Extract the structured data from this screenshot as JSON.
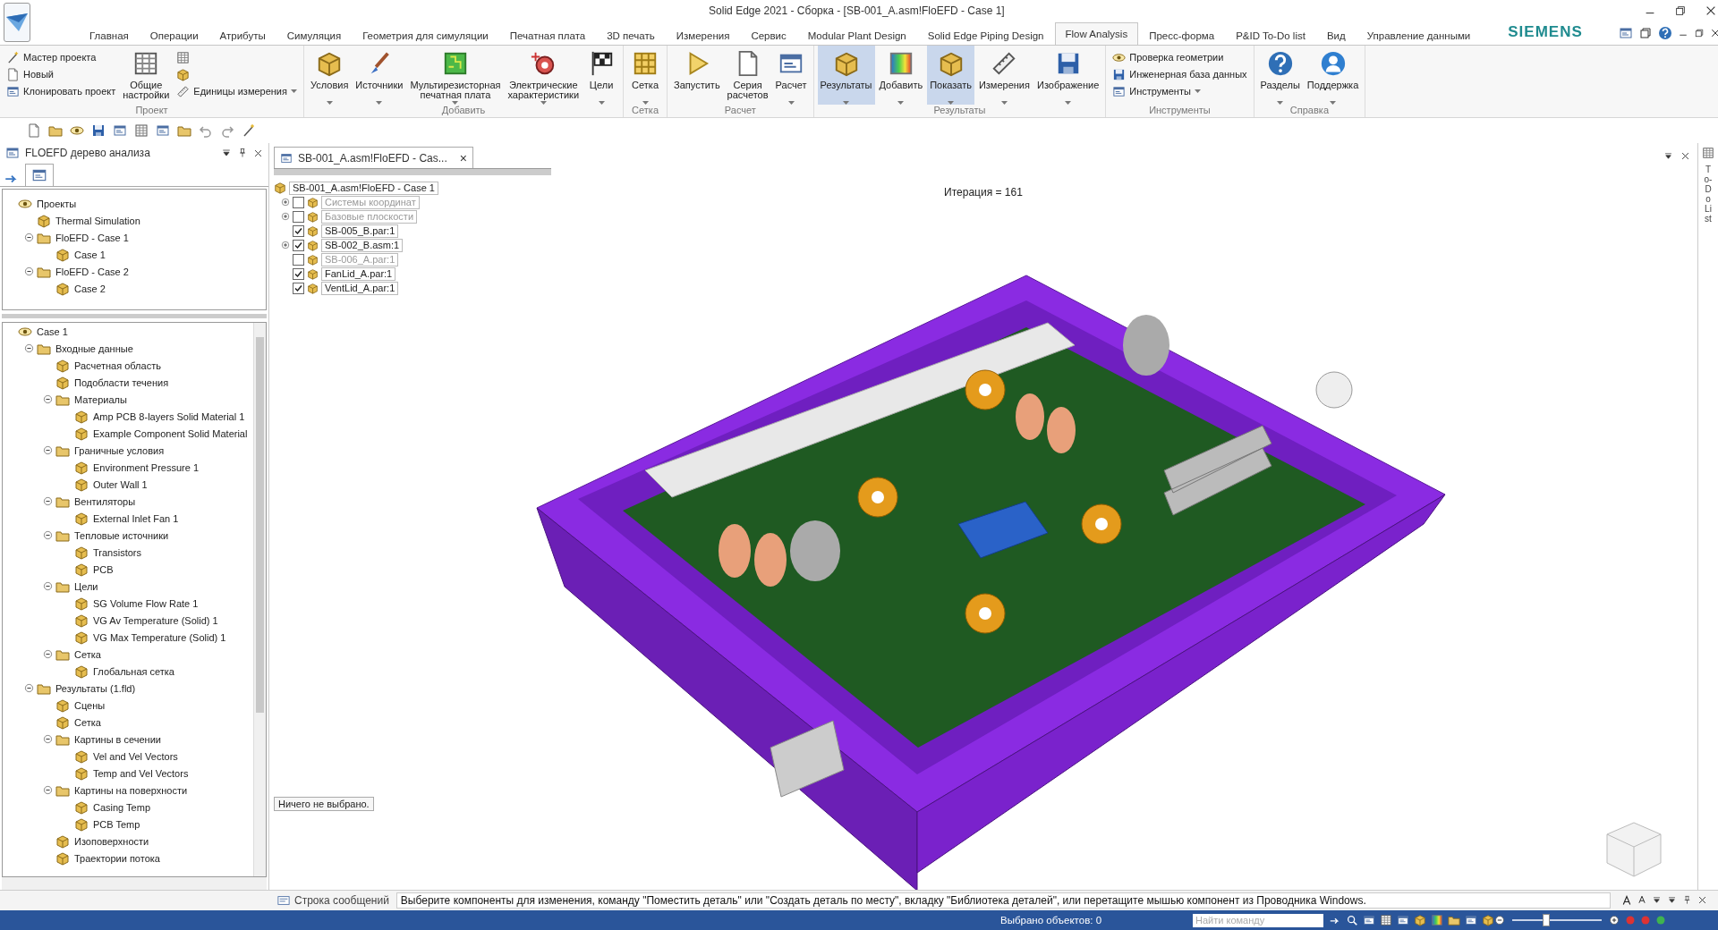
{
  "window": {
    "title": "Solid Edge 2021 - Сборка - [SB-001_A.asm!FloEFD - Case 1]"
  },
  "ribbon_tabs": [
    {
      "label": "Главная",
      "selected": false
    },
    {
      "label": "Операции",
      "selected": false
    },
    {
      "label": "Атрибуты",
      "selected": false
    },
    {
      "label": "Симуляция",
      "selected": false
    },
    {
      "label": "Геометрия для симуляции",
      "selected": false
    },
    {
      "label": "Печатная плата",
      "selected": false
    },
    {
      "label": "3D печать",
      "selected": false
    },
    {
      "label": "Измерения",
      "selected": false
    },
    {
      "label": "Сервис",
      "selected": false
    },
    {
      "label": "Modular Plant Design",
      "selected": false
    },
    {
      "label": "Solid Edge Piping Design",
      "selected": false
    },
    {
      "label": "Flow Analysis",
      "selected": true
    },
    {
      "label": "Пресс-форма",
      "selected": false
    },
    {
      "label": "P&ID To-Do list",
      "selected": false
    },
    {
      "label": "Вид",
      "selected": false
    },
    {
      "label": "Управление данными",
      "selected": false
    }
  ],
  "brand": "SIEMENS",
  "ribbon_groups": [
    {
      "title": "Проект",
      "items": [
        {
          "kind": "small_stack",
          "items": [
            {
              "label": "Мастер проекта",
              "dropdown": false
            },
            {
              "label": "Новый",
              "dropdown": false
            },
            {
              "label": "Клонировать проект",
              "dropdown": false
            }
          ]
        },
        {
          "kind": "large",
          "label": "Общие\nнастройки",
          "dropdown": false,
          "active": false
        },
        {
          "kind": "small_stack",
          "items": [
            {
              "dropdown": false
            },
            {
              "dropdown": false
            },
            {
              "label": "Единицы измерения",
              "dropdown": true
            }
          ]
        }
      ]
    },
    {
      "title": "Добавить",
      "items": [
        {
          "kind": "large",
          "label": "Условия",
          "dropdown": true,
          "active": false
        },
        {
          "kind": "large",
          "label": "Источники",
          "dropdown": true,
          "active": false
        },
        {
          "kind": "large",
          "label": "Мультирезисторная\nпечатная плата",
          "dropdown": true,
          "active": false
        },
        {
          "kind": "large",
          "label": "Электрические\nхарактеристики",
          "dropdown": true,
          "active": false
        },
        {
          "kind": "large",
          "label": "Цели",
          "dropdown": true,
          "active": false
        }
      ]
    },
    {
      "title": "Сетка",
      "items": [
        {
          "kind": "large",
          "label": "Сетка",
          "dropdown": true,
          "active": false
        }
      ]
    },
    {
      "title": "Расчет",
      "items": [
        {
          "kind": "large",
          "label": "Запустить",
          "dropdown": false,
          "active": false
        },
        {
          "kind": "large",
          "label": "Серия\nрасчетов",
          "dropdown": false,
          "active": false
        },
        {
          "kind": "large",
          "label": "Расчет",
          "dropdown": true,
          "active": false
        }
      ]
    },
    {
      "title": "Результаты",
      "items": [
        {
          "kind": "large",
          "label": "Результаты",
          "dropdown": true,
          "active": true
        },
        {
          "kind": "large",
          "label": "Добавить",
          "dropdown": true,
          "active": false
        },
        {
          "kind": "large",
          "label": "Показать",
          "dropdown": true,
          "active": true
        },
        {
          "kind": "large",
          "label": "Измерения",
          "dropdown": true,
          "active": false
        },
        {
          "kind": "large",
          "label": "Изображение",
          "dropdown": true,
          "active": false
        }
      ]
    },
    {
      "title": "Инструменты",
      "items": [
        {
          "kind": "small_stack",
          "items": [
            {
              "label": "Проверка геометрии",
              "dropdown": false
            },
            {
              "label": "Инженерная база данных",
              "dropdown": false
            },
            {
              "label": "Инструменты",
              "dropdown": true
            }
          ]
        }
      ]
    },
    {
      "title": "Справка",
      "items": [
        {
          "kind": "large",
          "label": "Разделы",
          "dropdown": true,
          "active": false
        },
        {
          "kind": "large",
          "label": "Поддержка",
          "dropdown": true,
          "active": false
        }
      ]
    }
  ],
  "analysis_pane": {
    "title": "FLOEFD дерево анализа",
    "projects_tree": [
      {
        "label": "Проекты",
        "children": [
          {
            "label": "Thermal Simulation"
          },
          {
            "label": "FloEFD - Case 1",
            "expanded": true,
            "children": [
              {
                "label": "Case 1"
              }
            ]
          },
          {
            "label": "FloEFD - Case 2",
            "expanded": true,
            "children": [
              {
                "label": "Case 2"
              }
            ]
          }
        ]
      }
    ],
    "case_tree": [
      {
        "label": "Case 1",
        "children": [
          {
            "label": "Входные данные",
            "expanded": true,
            "children": [
              {
                "label": "Расчетная область"
              },
              {
                "label": "Подобласти течения"
              },
              {
                "label": "Материалы",
                "expanded": true,
                "children": [
                  {
                    "label": "Amp PCB 8-layers Solid Material 1"
                  },
                  {
                    "label": "Example Component Solid Material"
                  }
                ]
              },
              {
                "label": "Граничные условия",
                "expanded": true,
                "children": [
                  {
                    "label": "Environment Pressure 1"
                  },
                  {
                    "label": "Outer Wall 1"
                  }
                ]
              },
              {
                "label": "Вентиляторы",
                "expanded": true,
                "children": [
                  {
                    "label": "External Inlet Fan 1"
                  }
                ]
              },
              {
                "label": "Тепловые источники",
                "expanded": true,
                "children": [
                  {
                    "label": "Transistors"
                  },
                  {
                    "label": "PCB"
                  }
                ]
              },
              {
                "label": "Цели",
                "expanded": true,
                "children": [
                  {
                    "label": "SG Volume Flow Rate 1"
                  },
                  {
                    "label": "VG Av Temperature (Solid) 1"
                  },
                  {
                    "label": "VG Max Temperature (Solid) 1"
                  }
                ]
              },
              {
                "label": "Сетка",
                "expanded": true,
                "children": [
                  {
                    "label": "Глобальная сетка"
                  }
                ]
              }
            ]
          },
          {
            "label": "Результаты (1.fld)",
            "expanded": true,
            "children": [
              {
                "label": "Сцены"
              },
              {
                "label": "Сетка"
              },
              {
                "label": "Картины в сечении",
                "expanded": true,
                "children": [
                  {
                    "label": "Vel and Vel Vectors"
                  },
                  {
                    "label": "Temp and Vel Vectors"
                  }
                ]
              },
              {
                "label": "Картины на поверхности",
                "expanded": true,
                "children": [
                  {
                    "label": "Casing Temp"
                  },
                  {
                    "label": "PCB Temp"
                  }
                ]
              },
              {
                "label": "Изоповерхности"
              },
              {
                "label": "Траектории потока"
              }
            ]
          }
        ]
      }
    ]
  },
  "document_tab": {
    "label": "SB-001_A.asm!FloEFD - Cas...",
    "close": "×"
  },
  "todo_label": "To-Do List",
  "assembly_tree": {
    "root": "SB-001_A.asm!FloEFD - Case 1",
    "items": [
      {
        "label": "Системы координат",
        "expandable": true,
        "checked": false,
        "dimmed": true
      },
      {
        "label": "Базовые плоскости",
        "expandable": true,
        "checked": false,
        "dimmed": true
      },
      {
        "label": "SB-005_B.par:1",
        "expandable": false,
        "checked": true,
        "dimmed": false
      },
      {
        "label": "SB-002_B.asm:1",
        "expandable": true,
        "checked": true,
        "dimmed": false
      },
      {
        "label": "SB-006_A.par:1",
        "expandable": false,
        "checked": false,
        "dimmed": true
      },
      {
        "label": "FanLid_A.par:1",
        "expandable": false,
        "checked": true,
        "dimmed": false
      },
      {
        "label": "VentLid_A.par:1",
        "expandable": false,
        "checked": true,
        "dimmed": false
      }
    ]
  },
  "iteration": "Итерация = 161",
  "selection_note": "Ничего не выбрано.",
  "message_bar": {
    "label": "Строка сообщений",
    "text": "Выберите компоненты для изменения, команду \"Поместить деталь\" или \"Создать деталь по месту\", вкладку \"Библиотека деталей\", или перетащите мышью компонент из Проводника Windows."
  },
  "status_bar": {
    "selected": "Выбрано объектов: 0",
    "search": {
      "placeholder": "Найти команду"
    },
    "zoom": {
      "level": 0.37
    }
  }
}
